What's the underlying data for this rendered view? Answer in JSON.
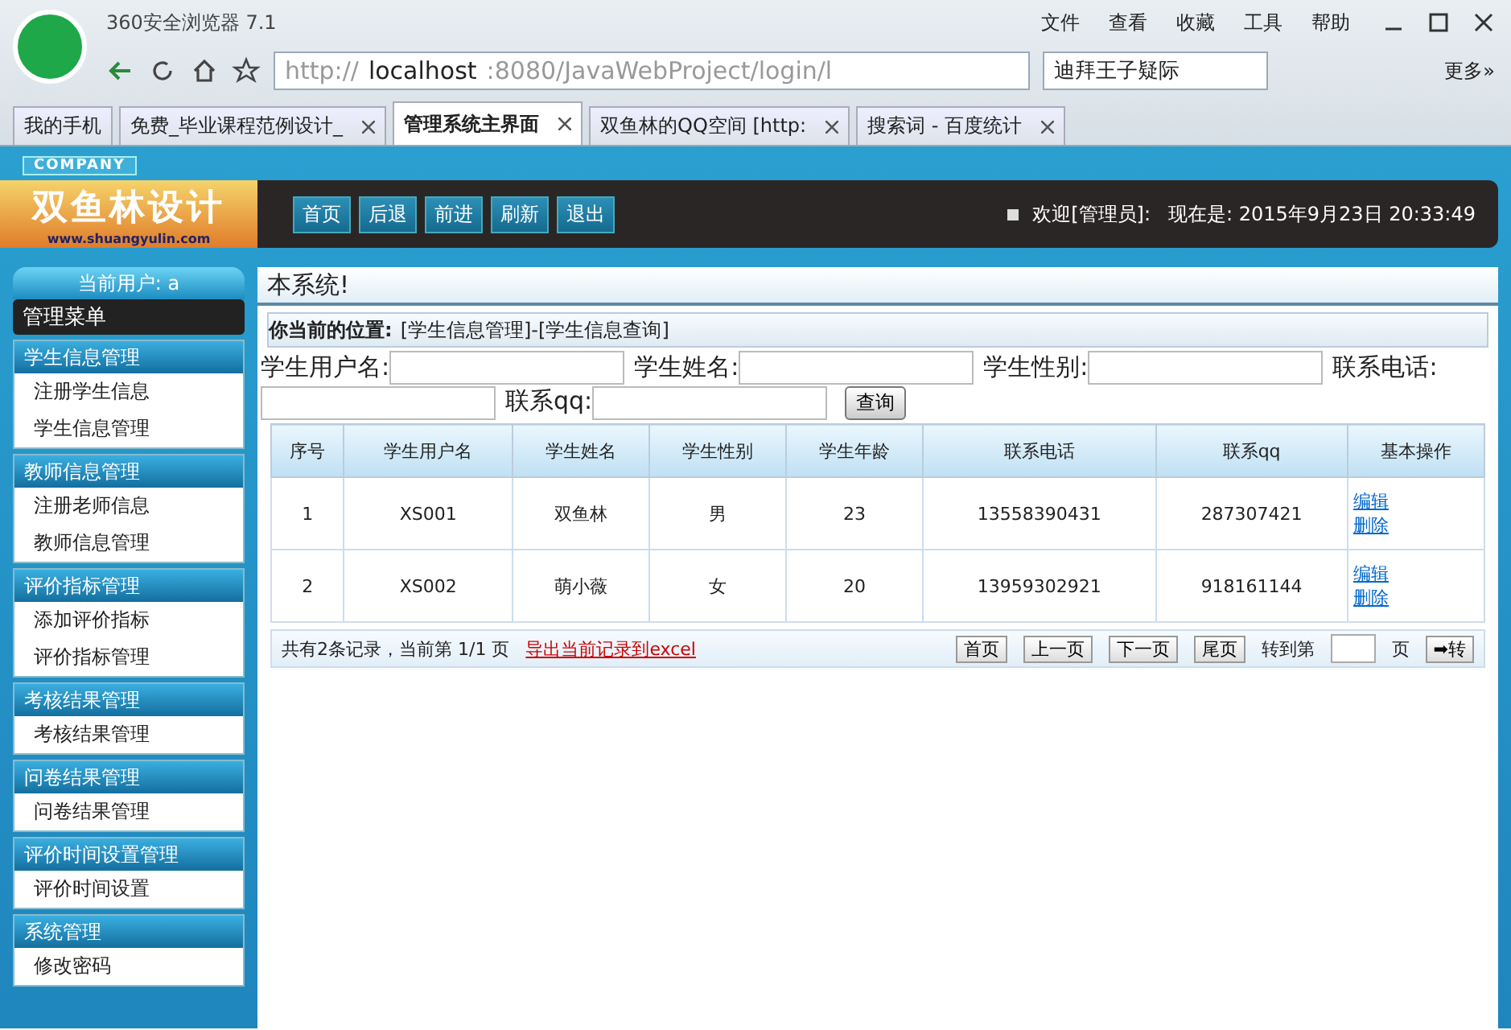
{
  "browser": {
    "title": "360安全浏览器 7.1",
    "menu": [
      "文件",
      "查看",
      "收藏",
      "工具",
      "帮助"
    ],
    "url": {
      "host": "localhost",
      "prefix": "http://",
      "rest": ":8080/JavaWebProject/login/l"
    },
    "search": {
      "value": "迪拜王子疑际"
    },
    "more": "更多»",
    "tabs": [
      {
        "label": "我的手机",
        "selected": false,
        "closable": false
      },
      {
        "label": "免费_毕业课程范例设计_",
        "selected": false,
        "closable": true
      },
      {
        "label": "管理系统主界面",
        "selected": true,
        "closable": true
      },
      {
        "label": "双鱼林的QQ空间 [http:",
        "selected": false,
        "closable": true
      },
      {
        "label": "搜索词 - 百度统计",
        "selected": false,
        "closable": true
      }
    ]
  },
  "header": {
    "badge": "COMPANY",
    "logo": "双鱼林设计",
    "logo_url": "www.shuangyulin.com",
    "nav": [
      "首页",
      "后退",
      "前进",
      "刷新",
      "退出"
    ],
    "welcome": "欢迎[管理员]:",
    "time": "现在是: 2015年9月23日 20:33:49"
  },
  "sidebar": {
    "user": "当前用户: a",
    "menu_title": "管理菜单",
    "groups": [
      {
        "title": "学生信息管理",
        "items": [
          "注册学生信息",
          "学生信息管理"
        ]
      },
      {
        "title": "教师信息管理",
        "items": [
          "注册老师信息",
          "教师信息管理"
        ]
      },
      {
        "title": "评价指标管理",
        "items": [
          "添加评价指标",
          "评价指标管理"
        ]
      },
      {
        "title": "考核结果管理",
        "items": [
          "考核结果管理"
        ]
      },
      {
        "title": "问卷结果管理",
        "items": [
          "问卷结果管理"
        ]
      },
      {
        "title": "评价时间设置管理",
        "items": [
          "评价时间设置"
        ]
      },
      {
        "title": "系统管理",
        "items": [
          "修改密码"
        ]
      }
    ]
  },
  "marquee": "本系统!",
  "location": {
    "label": "你当前的位置:",
    "path": "[学生信息管理]-[学生信息查询]"
  },
  "search_form": {
    "fields": [
      "学生用户名:",
      "学生姓名:",
      "学生性别:",
      "联系电话:",
      "联系qq:"
    ],
    "button": "查询"
  },
  "table": {
    "columns": [
      "序号",
      "学生用户名",
      "学生姓名",
      "学生性别",
      "学生年龄",
      "联系电话",
      "联系qq",
      "基本操作"
    ],
    "rows": [
      {
        "cells": [
          "1",
          "XS001",
          "双鱼林",
          "男",
          "23",
          "13558390431",
          "287307421"
        ],
        "actions": [
          "编辑",
          "删除"
        ]
      },
      {
        "cells": [
          "2",
          "XS002",
          "萌小薇",
          "女",
          "20",
          "13959302921",
          "918161144"
        ],
        "actions": [
          "编辑",
          "删除"
        ]
      }
    ]
  },
  "footer": {
    "summary": "共有2条记录，当前第 1/1 页",
    "export": "导出当前记录到excel",
    "pager": [
      "首页",
      "上一页",
      "下一页",
      "尾页"
    ],
    "goto": "转到第",
    "page": "页",
    "go": "➡转"
  }
}
